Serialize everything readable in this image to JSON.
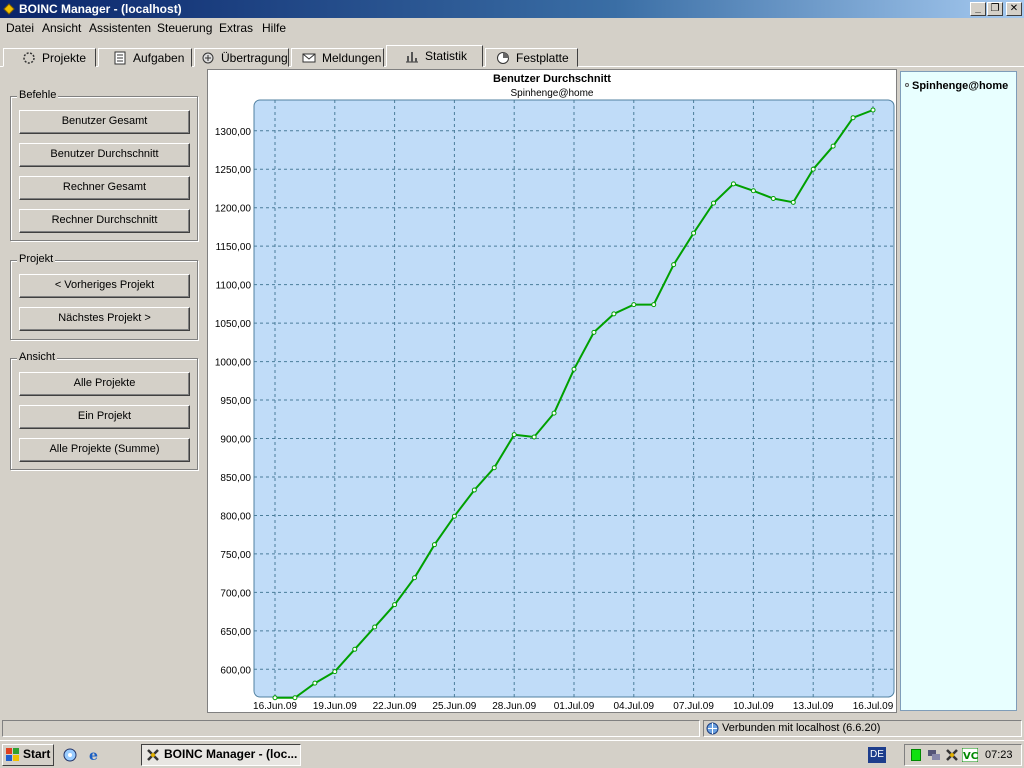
{
  "window": {
    "title": "BOINC Manager - (localhost)"
  },
  "menu": [
    "Datei",
    "Ansicht",
    "Assistenten",
    "Steuerung",
    "Extras",
    "Hilfe"
  ],
  "tabs": [
    "Projekte",
    "Aufgaben",
    "Übertragung",
    "Meldungen",
    "Statistik",
    "Festplatte"
  ],
  "active_tab": "Statistik",
  "groups": {
    "befehle": {
      "title": "Befehle",
      "buttons": [
        "Benutzer Gesamt",
        "Benutzer Durchschnitt",
        "Rechner Gesamt",
        "Rechner Durchschnitt"
      ]
    },
    "projekt": {
      "title": "Projekt",
      "buttons": [
        "< Vorheriges Projekt",
        "Nächstes Projekt >"
      ]
    },
    "ansicht": {
      "title": "Ansicht",
      "buttons": [
        "Alle Projekte",
        "Ein Projekt",
        "Alle Projekte (Summe)"
      ]
    }
  },
  "legend": {
    "items": [
      "Spinhenge@home"
    ]
  },
  "status": {
    "connection": "Verbunden mit localhost (6.6.20)"
  },
  "taskbar": {
    "start": "Start",
    "task": "BOINC Manager - (loc...",
    "lang": "DE",
    "clock": "07:23"
  },
  "colors": {
    "line": "#00a000",
    "plot_bg": "#c0dcf8",
    "grid": "#4a7d9a",
    "legend_bg": "#e8ffff"
  },
  "chart_data": {
    "type": "line",
    "title": "Benutzer Durchschnitt",
    "subtitle": "Spinhenge@home",
    "x_ticks": [
      "16.Jun.09",
      "19.Jun.09",
      "22.Jun.09",
      "25.Jun.09",
      "28.Jun.09",
      "01.Jul.09",
      "04.Jul.09",
      "07.Jul.09",
      "10.Jul.09",
      "13.Jul.09",
      "16.Jul.09"
    ],
    "y_ticks": [
      "600,00",
      "650,00",
      "700,00",
      "750,00",
      "800,00",
      "850,00",
      "900,00",
      "950,00",
      "1000,00",
      "1050,00",
      "1100,00",
      "1150,00",
      "1200,00",
      "1250,00",
      "1300,00"
    ],
    "ylim": [
      564,
      1340
    ],
    "x_range_days": [
      0,
      30
    ],
    "grid": true,
    "series": [
      {
        "name": "Spinhenge@home",
        "points": [
          [
            0,
            563
          ],
          [
            1,
            563
          ],
          [
            2,
            582
          ],
          [
            3,
            597
          ],
          [
            4,
            626
          ],
          [
            5,
            655
          ],
          [
            6,
            684
          ],
          [
            7,
            719
          ],
          [
            8,
            762
          ],
          [
            9,
            799
          ],
          [
            10,
            833
          ],
          [
            11,
            862
          ],
          [
            12,
            905
          ],
          [
            13,
            902
          ],
          [
            14,
            933
          ],
          [
            15,
            990
          ],
          [
            16,
            1038
          ],
          [
            17,
            1062
          ],
          [
            18,
            1074
          ],
          [
            19,
            1074
          ],
          [
            20,
            1126
          ],
          [
            21,
            1167
          ],
          [
            22,
            1206
          ],
          [
            23,
            1231
          ],
          [
            24,
            1222
          ],
          [
            25,
            1212
          ],
          [
            26,
            1207
          ],
          [
            27,
            1250
          ],
          [
            28,
            1280
          ],
          [
            29,
            1317
          ],
          [
            30,
            1327
          ]
        ]
      }
    ]
  }
}
